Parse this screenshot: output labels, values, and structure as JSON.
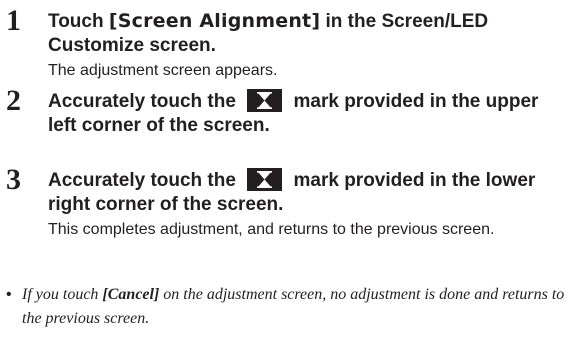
{
  "steps": [
    {
      "number": "1",
      "title_prefix": "Touch ",
      "title_key": "[Screen Alignment]",
      "title_suffix": " in the Screen/LED Customize screen.",
      "description": "The adjustment screen appears."
    },
    {
      "number": "2",
      "title_prefix": "Accurately touch the",
      "title_suffix": "mark provided in the upper left corner of the screen.",
      "icon": "alignment-mark-icon"
    },
    {
      "number": "3",
      "title_prefix": "Accurately touch the",
      "title_suffix": "mark provided in the lower right corner of the screen.",
      "icon": "alignment-mark-icon",
      "description": "This completes adjustment, and returns to the previous screen."
    }
  ],
  "note": {
    "bullet": "•",
    "prefix": "If you touch ",
    "key": "[Cancel]",
    "suffix": " on the adjustment screen, no adjustment is done and returns to the previous screen."
  }
}
